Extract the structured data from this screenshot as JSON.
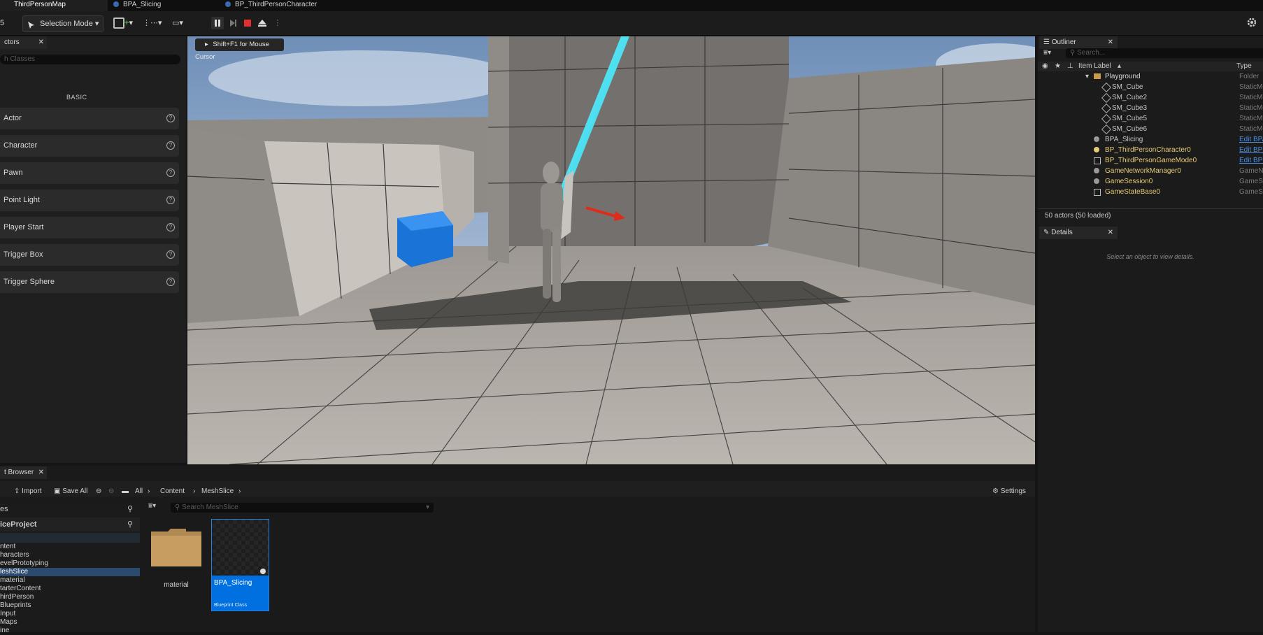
{
  "tabs": [
    {
      "label": "ThirdPersonMap",
      "active": true
    },
    {
      "label": "BPA_Slicing",
      "active": false
    },
    {
      "label": "BP_ThirdPersonCharacter",
      "active": false
    }
  ],
  "toolbar": {
    "left_digit": "5",
    "mode_label": "Selection Mode",
    "icons": [
      "add-actor-icon",
      "blueprint-icon",
      "cinematics-icon",
      "pause-icon",
      "skip-frame-icon",
      "stop-icon",
      "eject-icon",
      "more-icon",
      "settings-icon"
    ]
  },
  "actors_panel": {
    "tab_label": "ctors",
    "search_placeholder": "h Classes",
    "category_label": "BASIC",
    "items": [
      "Actor",
      "Character",
      "Pawn",
      "Point Light",
      "Player Start",
      "Trigger Box",
      "Trigger Sphere"
    ]
  },
  "viewport": {
    "hint": "Shift+F1 for Mouse Cursor"
  },
  "outliner": {
    "tab_label": "Outliner",
    "search_placeholder": "Search...",
    "col_label": "Item Label",
    "col_type": "Type",
    "rows": [
      {
        "name": "Playground",
        "type": "Folder",
        "link": false
      },
      {
        "name": "SM_Cube",
        "type": "StaticMe",
        "link": false
      },
      {
        "name": "SM_Cube2",
        "type": "StaticMe",
        "link": false
      },
      {
        "name": "SM_Cube3",
        "type": "StaticMe",
        "link": false
      },
      {
        "name": "SM_Cube5",
        "type": "StaticMe",
        "link": false
      },
      {
        "name": "SM_Cube6",
        "type": "StaticMe",
        "link": false
      },
      {
        "name": "BPA_Slicing",
        "type": "Edit BPA",
        "link": true
      },
      {
        "name": "BP_ThirdPersonCharacter0",
        "type": "Edit BP_",
        "link": true
      },
      {
        "name": "BP_ThirdPersonGameMode0",
        "type": "Edit BP_",
        "link": true
      },
      {
        "name": "GameNetworkManager0",
        "type": "GameNe",
        "link": false
      },
      {
        "name": "GameSession0",
        "type": "GameSe",
        "link": false
      },
      {
        "name": "GameStateBase0",
        "type": "GameSt",
        "link": false
      }
    ],
    "status": "50 actors (50 loaded)"
  },
  "details": {
    "tab_label": "Details",
    "empty_text": "Select an object to view details."
  },
  "content_browser": {
    "tab_label": "t Browser",
    "import_label": "Import",
    "save_all_label": "Save All",
    "breadcrumb": [
      "All",
      "Content",
      "MeshSlice"
    ],
    "settings_label": "Settings",
    "search_placeholder": "Search MeshSlice",
    "tree_header": "es",
    "project_label": "iceProject",
    "tree_items": [
      "ntent",
      "haracters",
      "evelPrototyping",
      "leshSlice",
      "material",
      "tarterContent",
      "hirdPerson",
      "Blueprints",
      "Input",
      "Maps",
      "ine"
    ],
    "tree_selected_index": 3,
    "assets": [
      {
        "name": "material",
        "kind": "folder"
      },
      {
        "name": "BPA_Slicing",
        "kind": "Blueprint Class"
      }
    ]
  },
  "colors": {
    "accent": "#0070e0",
    "stop_red": "#e03030",
    "link_blue": "#4d8ee0",
    "name_yellow": "#e6cc74"
  }
}
